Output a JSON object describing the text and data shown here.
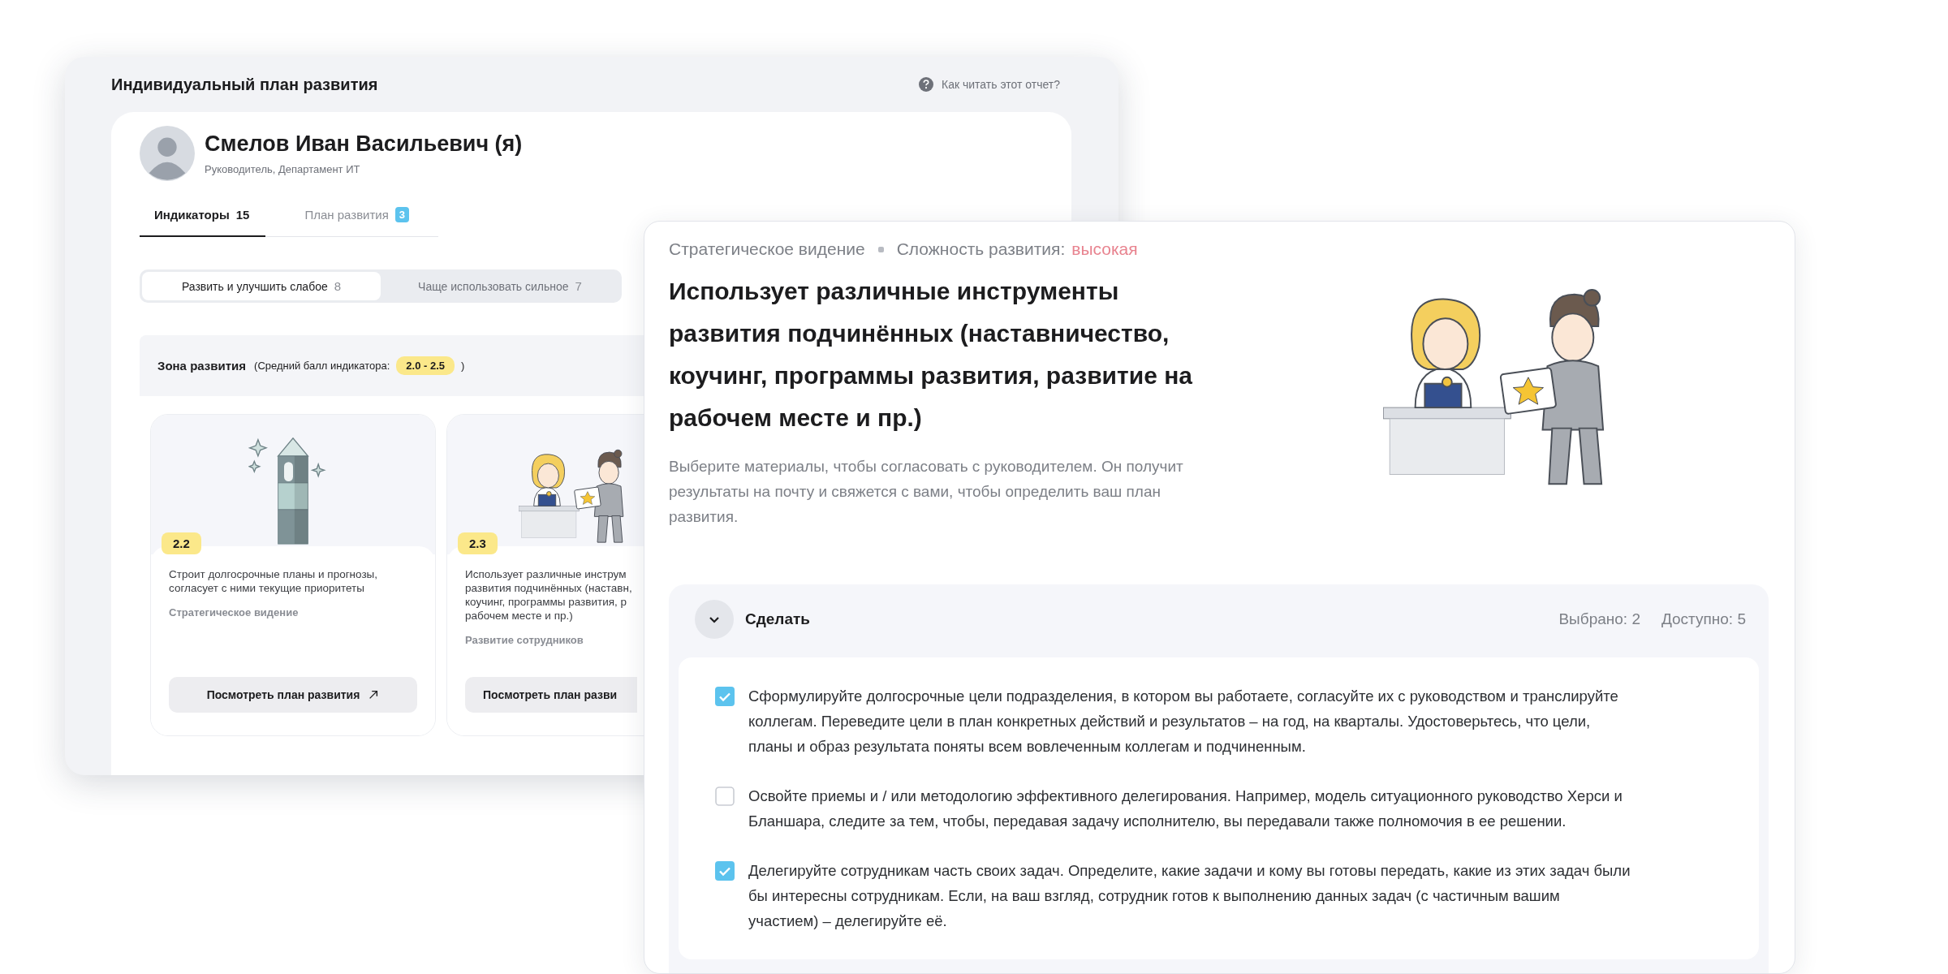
{
  "report": {
    "title": "Индивидуальный план развития",
    "help_link": "Как читать этот отчет?"
  },
  "profile": {
    "name": "Смелов Иван Васильевич (я)",
    "position": "Руководитель, Департамент ИТ"
  },
  "tabs": [
    {
      "label": "Индикаторы",
      "count": "15",
      "selected": true
    },
    {
      "label": "План развития",
      "count": "3",
      "selected": false
    }
  ],
  "segments": [
    {
      "label": "Развить и улучшить слабое",
      "count": "8",
      "selected": true
    },
    {
      "label": "Чаще использовать сильное",
      "count": "7",
      "selected": false
    }
  ],
  "zone": {
    "title": "Зона развития",
    "note_prefix": "(Средний балл индикатора:",
    "score_range": "2.0 - 2.5",
    "note_suffix": ")"
  },
  "cards": [
    {
      "kind": "tower",
      "score": "2.2",
      "text": "Строит долгосрочные планы и прогнозы, согласует с ними текущие приоритеты",
      "category": "Стратегическое видение",
      "button": "Посмотреть план развития",
      "arrow": true
    },
    {
      "kind": "people",
      "score": "2.3",
      "text": "Использует различные инструм\nразвития подчинённых (наставн,\nкоучинг, программы развития, р\nрабочем месте и пр.)",
      "category": "Развитие сотрудников",
      "button": "Посмотреть план разви",
      "arrow": false
    }
  ],
  "detail": {
    "category": "Стратегическое видение",
    "difficulty_label": "Сложность развития:",
    "difficulty": "высокая",
    "title": "Использует различные инструменты развития подчинённых (наставничество, коучинг, программы развития, развитие на рабочем месте и пр.)",
    "description": "Выберите материалы, чтобы согласовать с руководителем. Он получит результаты на почту и свяжется с вами, чтобы определить ваш план развития.",
    "section": {
      "title": "Сделать",
      "expanded": true,
      "selected_count": "Выбрано: 2",
      "available_count": "Доступно: 5",
      "items": [
        {
          "text": "Сформулируйте долгосрочные цели подразделения, в котором вы работаете, согласуйте их с руководством и транслируйте коллегам. Переведите цели в план конкретных действий и результатов – на год, на кварталы. Удостоверьтесь, что цели, планы и образ результата поняты всем вовлеченным коллегам и подчиненным.",
          "checked": true
        },
        {
          "text": "Освойте приемы и / или методологию эффективного делегирования. Например, модель ситуационного руководство Херси и Бланшара, следите за тем, чтобы, передавая задачу исполнителю, вы передавали также полномочия в ее решении.",
          "checked": false
        },
        {
          "text": "Делегируйте сотрудникам часть своих задач. Определите, какие задачи и кому вы готовы передать, какие из этих задач были бы интересны сотрудникам. Если, на ваш взгляд, сотрудник готов к выполнению данных задач (с частичным вашим участием) – делегируйте её.",
          "checked": true
        }
      ]
    }
  }
}
